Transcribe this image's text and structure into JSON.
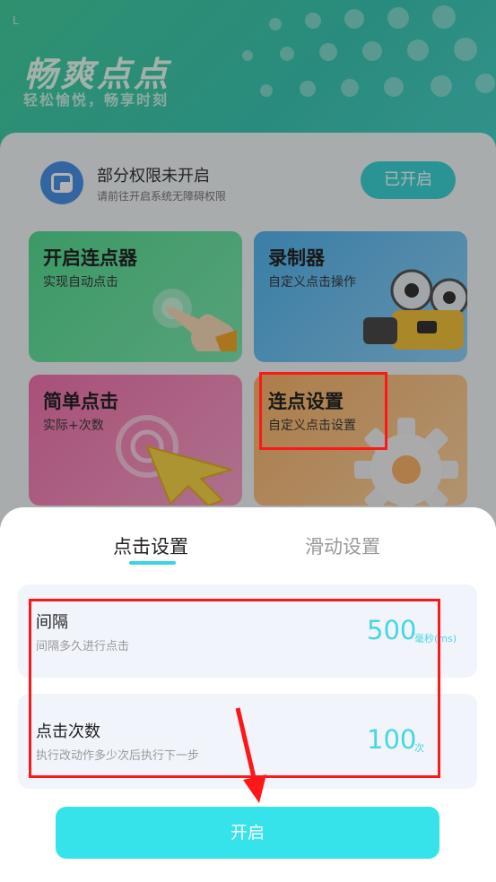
{
  "app": {
    "status_char": "L",
    "title": "畅爽点点",
    "subtitle": "轻松愉悦，畅享时刻"
  },
  "permission": {
    "title": "部分权限未开启",
    "desc": "请前往开启系统无障碍权限",
    "button": "已开启"
  },
  "cards": [
    {
      "title": "开启连点器",
      "sub": "实现自动点击",
      "icon": "hand-tap-icon"
    },
    {
      "title": "录制器",
      "sub": "自定义点击操作",
      "icon": "film-camera-icon"
    },
    {
      "title": "简单点击",
      "sub": "实际+次数",
      "icon": "cursor-arrow-icon"
    },
    {
      "title": "连点设置",
      "sub": "自定义点击设置",
      "icon": "gear-icon"
    }
  ],
  "sheet": {
    "tabs": [
      "点击设置",
      "滑动设置"
    ],
    "active_tab": "点击设置",
    "settings": [
      {
        "title": "间隔",
        "desc": "间隔多久进行点击",
        "value": "500",
        "unit": "毫秒(ms)"
      },
      {
        "title": "点击次数",
        "desc": "执行改动作多少次后执行下一步",
        "value": "100",
        "unit": "次"
      }
    ],
    "start_button": "开启"
  },
  "colors": {
    "accent": "#36e3eb",
    "header": "#43cf9f",
    "annotation": "#ff1616"
  }
}
